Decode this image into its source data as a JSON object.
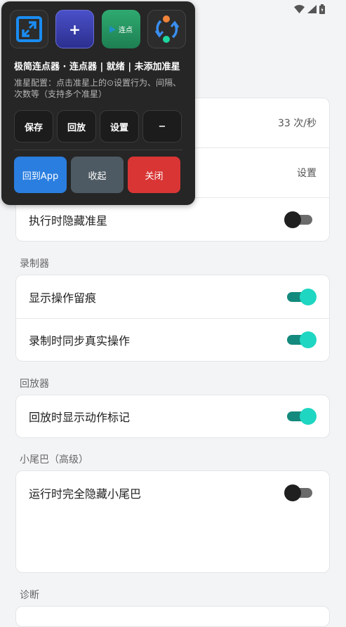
{
  "status_bar": {
    "icons": [
      "wifi-icon",
      "signal-icon",
      "battery-icon"
    ]
  },
  "panel": {
    "tool_icons": [
      "crop-frame-icon",
      "add-point-icon",
      "play-clicker-icon",
      "sync-icon"
    ],
    "add_symbol": "+",
    "clicker_label": "连点",
    "title": "极简连点器 · 连点器 | 就绪 | 未添加准星",
    "description": "准星配置：点击准星上的⊙设置行为、间隔、次数等（支持多个准星）",
    "buttons": {
      "save": "保存",
      "replay": "回放",
      "settings": "设置",
      "minus": "−"
    },
    "bottom": {
      "back_to_app": "回到App",
      "collapse": "收起",
      "close": "关闭"
    },
    "colors": {
      "back_to_app": "#2a7ee0",
      "collapse": "#4d5a63",
      "close": "#d93535",
      "accent": "#1a8cf2"
    }
  },
  "card1": {
    "rows": [
      {
        "label": "",
        "value": "33 次/秒"
      },
      {
        "label": "",
        "value": "设置"
      },
      {
        "label": "执行时隐藏准星",
        "toggle": "off"
      }
    ]
  },
  "sections": {
    "recorder": {
      "title": "录制器",
      "rows": [
        {
          "label": "显示操作留痕",
          "toggle": "on"
        },
        {
          "label": "录制时同步真实操作",
          "toggle": "on"
        }
      ]
    },
    "player": {
      "title": "回放器",
      "rows": [
        {
          "label": "回放时显示动作标记",
          "toggle": "on"
        }
      ]
    },
    "tail": {
      "title": "小尾巴（高级）",
      "rows": [
        {
          "label": "运行时完全隐藏小尾巴",
          "toggle": "off"
        }
      ]
    },
    "diagnostics": {
      "title": "诊断"
    }
  },
  "colors": {
    "toggle_on_track": "#138a7d",
    "toggle_on_knob": "#1fd6c2"
  }
}
